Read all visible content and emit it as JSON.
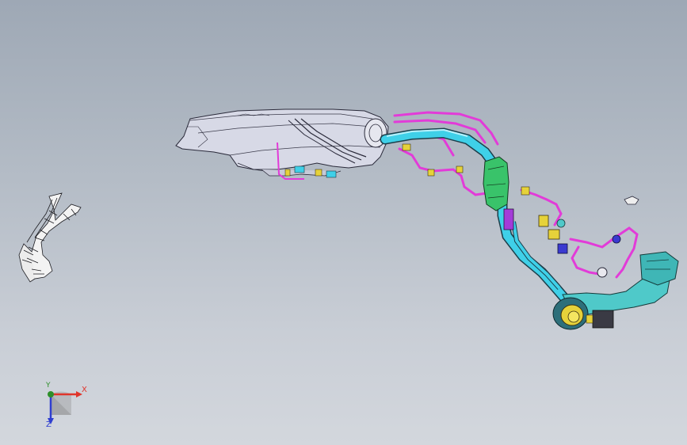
{
  "viewport": {
    "background_top": "#9ea8b5",
    "background_bottom": "#d3d7dd",
    "description_kind": "3D CAD graphics area"
  },
  "model": {
    "colors": {
      "tank_body": "#d7d9e6",
      "tank_outline": "#2a2a3a",
      "filler_pipe": "#3fd0e8",
      "vent_line": "#e23bd8",
      "canister": "#39c36a",
      "clip": "#e6d23a",
      "neck": "#4fc9c9"
    }
  },
  "triad": {
    "x_label": "X",
    "y_label": "Y",
    "z_label": "Z",
    "x_color": "#e0352b",
    "y_color": "#2e8f2a",
    "z_color": "#2f3fd0"
  }
}
